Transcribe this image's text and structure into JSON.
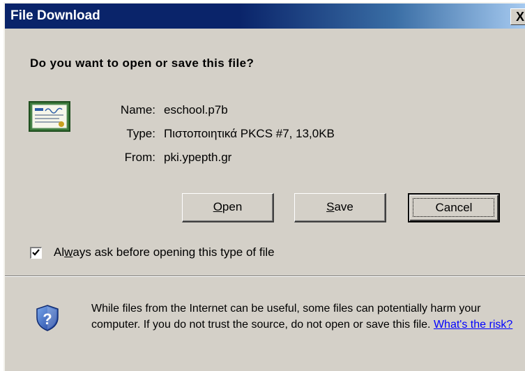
{
  "dialog": {
    "title": "File Download",
    "close_glyph": "X",
    "question": "Do you want to open or save this file?"
  },
  "file": {
    "icon": "certificate-icon",
    "name_label": "Name:",
    "name_value": "eschool.p7b",
    "type_label": "Type:",
    "type_value": "Πιστοποιητικά PKCS #7, 13,0KB",
    "from_label": "From:",
    "from_value": "pki.ypepth.gr"
  },
  "buttons": {
    "open_mnemonic": "O",
    "open_rest": "pen",
    "save_mnemonic": "S",
    "save_rest": "ave",
    "cancel": "Cancel"
  },
  "checkbox": {
    "checked": true,
    "label_before": "Al",
    "label_mnemonic": "w",
    "label_after": "ays ask before opening this type of file"
  },
  "warning": {
    "icon": "shield-question-icon",
    "text": "While files from the Internet can be useful, some files can potentially harm your computer. If you do not trust the source, do not open or save this file. ",
    "link": "What's the risk?"
  },
  "colors": {
    "title_bar": "#0a246a",
    "dialog_face": "#d4d0c8",
    "link": "#0000ff"
  }
}
